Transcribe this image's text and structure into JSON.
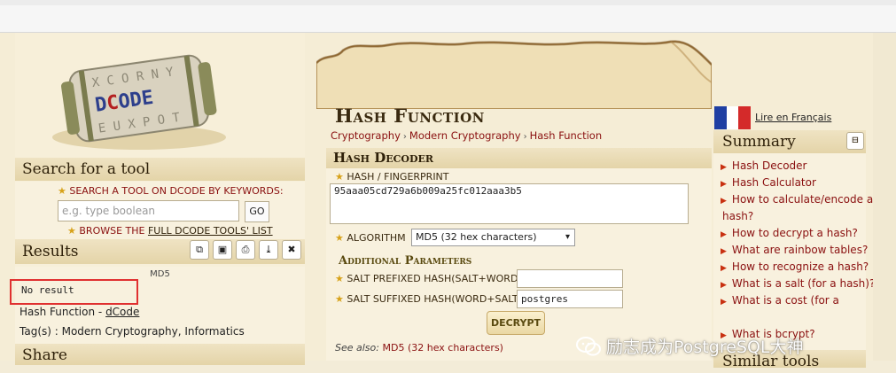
{
  "left": {
    "search": {
      "heading": "Search for a tool",
      "prompt": "SEARCH A TOOL ON DCODE BY KEYWORDS:",
      "placeholder": "e.g. type boolean",
      "go_label": "GO",
      "browse_prefix": "BROWSE THE ",
      "browse_link": "FULL DCODE TOOLS' LIST"
    },
    "results": {
      "heading": "Results",
      "tool_icons": [
        "copy-icon",
        "save-icon",
        "print-icon",
        "download-icon",
        "close-icon"
      ],
      "type_label": "MD5",
      "value": "No result",
      "source_prefix": "Hash Function - ",
      "source_link": "dCode",
      "tags": "Tag(s) : Modern Cryptography, Informatics"
    },
    "share_heading": "Share"
  },
  "center": {
    "title": "Hash Function",
    "breadcrumbs": [
      "Cryptography",
      "Modern Cryptography",
      "Hash Function"
    ],
    "decoder": {
      "heading": "Hash Decoder",
      "hash_label": "HASH / FINGERPRINT",
      "hash_value": "95aaa05cd729a6b009a25fc012aaa3b5",
      "algorithm_label": "ALGORITHM",
      "algorithm_value": "MD5 (32 hex characters)",
      "additional_heading": "Additional Parameters",
      "salt_prefixed_label": "SALT PREFIXED HASH(SALT+WORD)",
      "salt_prefixed_value": "",
      "salt_suffixed_label": "SALT SUFFIXED HASH(WORD+SALT)",
      "salt_suffixed_value": "postgres",
      "decrypt_label": "DECRYPT",
      "see_also_prefix": "See also: ",
      "see_also_link": "MD5 (32 hex characters)"
    }
  },
  "right": {
    "lang_link": "Lire en Français",
    "summary_heading": "Summary",
    "summary_items": [
      "Hash Decoder",
      "Hash Calculator",
      "How to calculate/encode a",
      "hash?",
      "How to decrypt a hash?",
      "What are rainbow tables?",
      "How to recognize a hash?",
      "What is a salt (for a hash)?",
      "What is a cost (for a",
      "What is bcrypt?"
    ],
    "similar_heading": "Similar tools"
  },
  "watermark": "励志成为PostgreSQL大神",
  "colors": {
    "link_red": "#8a1010",
    "bullet": "#c83010",
    "star": "#d7a21a",
    "highlight_box": "#e03030"
  }
}
